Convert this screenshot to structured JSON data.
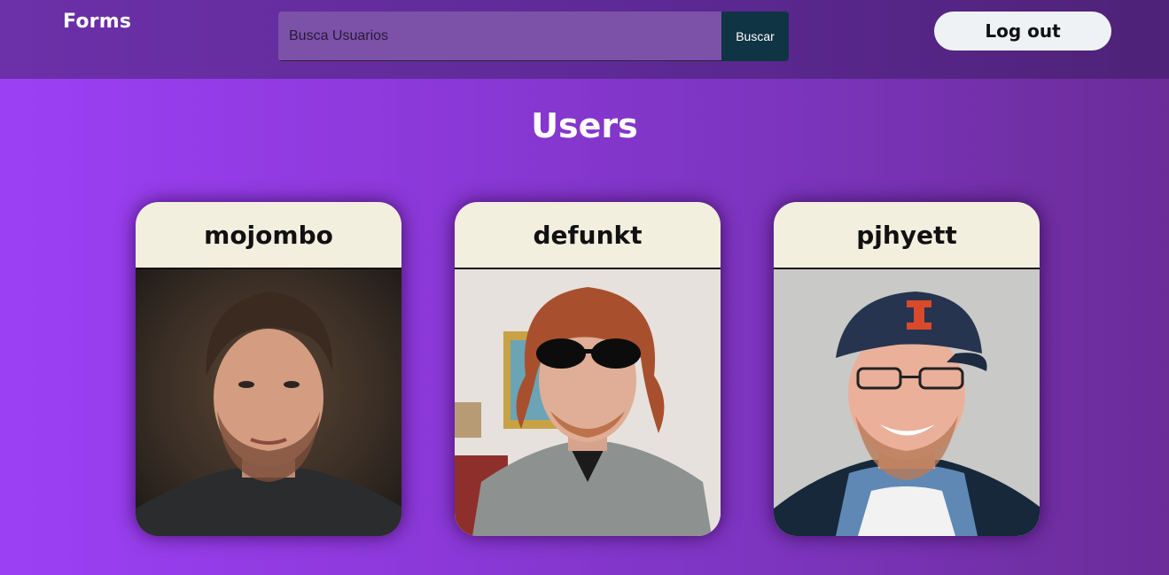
{
  "header": {
    "brand": "Forms",
    "search": {
      "placeholder": "Busca Usuarios",
      "value": ""
    },
    "search_button": "Buscar",
    "logout_button": "Log out"
  },
  "main": {
    "title": "Users",
    "users": [
      {
        "login": "mojombo"
      },
      {
        "login": "defunkt"
      },
      {
        "login": "pjhyett"
      }
    ]
  },
  "colors": {
    "background_gradient_start": "#9c40f5",
    "header_bg": "#5f2a98",
    "search_button_bg": "#0f3444",
    "card_header_bg": "#f3efdf"
  }
}
